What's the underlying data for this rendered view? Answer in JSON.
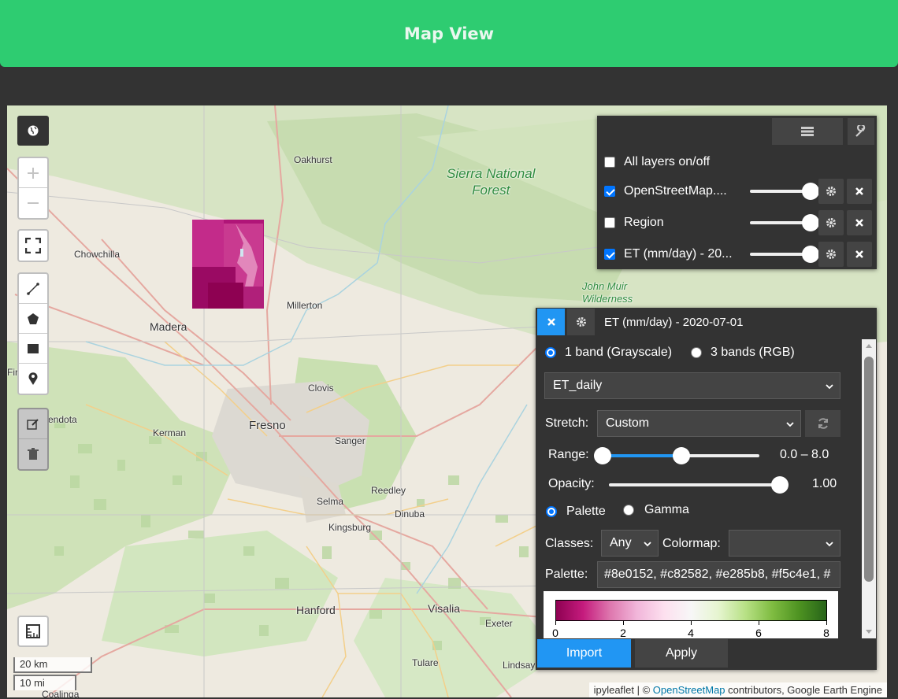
{
  "header": {
    "title": "Map View"
  },
  "map": {
    "places": {
      "oakhurst": "Oakhurst",
      "sierra_forest": "Sierra National\nForest",
      "chowchilla": "Chowchilla",
      "madera": "Madera",
      "millerton": "Millerton",
      "john_muir": "John Muir\nWilderness",
      "clovis": "Clovis",
      "firebaugh": "Fir",
      "mendota": "endota",
      "kerman": "Kerman",
      "fresno": "Fresno",
      "sanger": "Sanger",
      "reedley": "Reedley",
      "selma": "Selma",
      "dinuba": "Dinuba",
      "kingsburg": "Kingsburg",
      "hanford": "Hanford",
      "visalia": "Visalia",
      "exeter": "Exeter",
      "tulare": "Tulare",
      "lindsay": "Lindsay",
      "coalinga": "Coalinga"
    },
    "scale": {
      "km": "20 km",
      "mi": "10 mi"
    },
    "attribution": {
      "prefix": "ipyleaflet | © ",
      "link": "OpenStreetMap",
      "suffix": " contributors, Google Earth Engine"
    }
  },
  "layers_panel": {
    "all_toggle": {
      "label": "All layers on/off",
      "checked": false
    },
    "rows": [
      {
        "label": "OpenStreetMap....",
        "checked": true,
        "opacity": 1.0
      },
      {
        "label": "Region",
        "checked": false,
        "opacity": 1.0
      },
      {
        "label": "ET (mm/day) - 20...",
        "checked": true,
        "opacity": 1.0
      }
    ]
  },
  "vis_panel": {
    "title": "ET (mm/day) - 2020-07-01",
    "band_mode": {
      "option1": "1 band (Grayscale)",
      "option2": "3 bands (RGB)",
      "selected": "option1"
    },
    "band": "ET_daily",
    "stretch_label": "Stretch:",
    "stretch": "Custom",
    "range_label": "Range:",
    "range_value": "0.0 – 8.0",
    "range_min": 0.0,
    "range_max": 8.0,
    "range_high_fraction": 0.5,
    "opacity_label": "Opacity:",
    "opacity_value": "1.00",
    "palette_mode": {
      "option1": "Palette",
      "option2": "Gamma",
      "selected": "option1"
    },
    "classes_label": "Classes:",
    "classes": "Any",
    "colormap_label": "Colormap:",
    "colormap": "",
    "palette_label": "Palette:",
    "palette": "#8e0152, #c82582, #e285b8, #f5c4e1, #",
    "colorbar": {
      "colors": [
        "#8e0152",
        "#c51b7d",
        "#de77ae",
        "#f1b6da",
        "#fde0ef",
        "#f7f7f7",
        "#e6f5d0",
        "#b8e186",
        "#7fbc41",
        "#4d9221",
        "#276419"
      ],
      "ticks": [
        "0",
        "2",
        "4",
        "6",
        "8"
      ]
    },
    "import_label": "Import",
    "apply_label": "Apply",
    "colors": {
      "accent": "#2196f3",
      "panel": "#333333"
    }
  }
}
